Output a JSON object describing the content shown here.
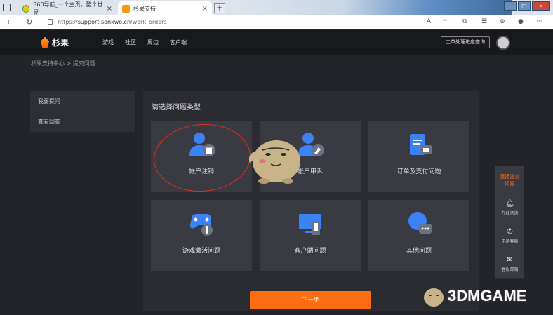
{
  "browser": {
    "tabs": [
      {
        "title": "360导航_一个主页，整个世界",
        "active": false
      },
      {
        "title": "杉果支持",
        "active": true
      }
    ],
    "url_scheme": "https://",
    "url_host": "support.sonkwo.cn",
    "url_path": "/work_orders"
  },
  "site": {
    "logo_text": "杉果",
    "nav": [
      "游戏",
      "社区",
      "周边",
      "客户端"
    ],
    "ticket_button": "工单处理进度查询"
  },
  "breadcrumb": "杉果支持中心 > 提交问题",
  "sidebar": {
    "items": [
      "我要提问",
      "查看回答"
    ]
  },
  "panel": {
    "title": "请选择问题类型",
    "cards": [
      {
        "label": "帐户注销",
        "icon": "user-delete-icon"
      },
      {
        "label": "帐户申诉",
        "icon": "user-appeal-icon"
      },
      {
        "label": "订单及支付问题",
        "icon": "order-payment-icon"
      },
      {
        "label": "游戏激活问题",
        "icon": "gamepad-key-icon"
      },
      {
        "label": "客户端问题",
        "icon": "client-device-icon"
      },
      {
        "label": "其他问题",
        "icon": "chat-bubble-icon"
      }
    ],
    "next_button": "下一步"
  },
  "floatbar": {
    "highlight": "直接提交问题",
    "items": [
      {
        "label": "在线咨询",
        "icon": "bell-icon"
      },
      {
        "label": "电话客服",
        "icon": "phone-icon"
      },
      {
        "label": "客服邮箱",
        "icon": "mail-icon"
      }
    ]
  },
  "watermark": "3DMGAME",
  "colors": {
    "accent": "#ff6d12",
    "icon_blue": "#3b82f6",
    "annotation_red": "#d9301e"
  }
}
